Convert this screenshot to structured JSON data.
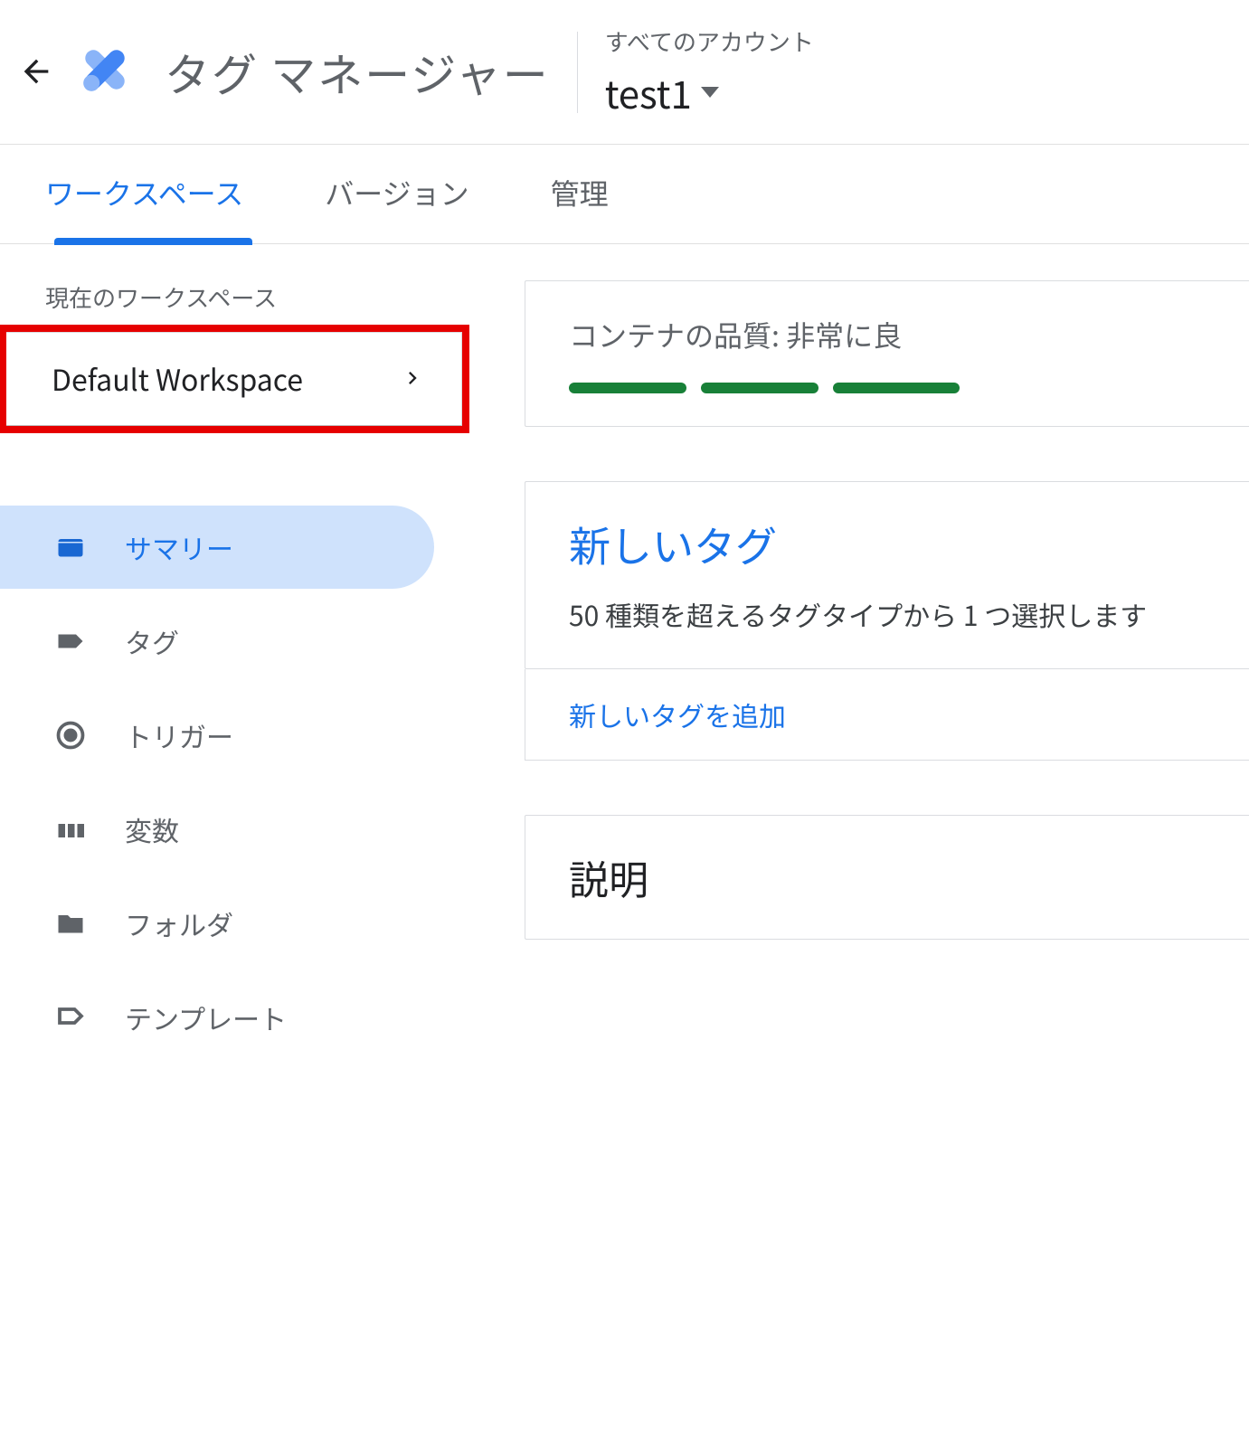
{
  "header": {
    "app_title": "タグ マネージャー",
    "account_label": "すべてのアカウント",
    "account_name": "test1"
  },
  "tabs": {
    "workspace": "ワークスペース",
    "version": "バージョン",
    "admin": "管理"
  },
  "sidebar": {
    "current_ws_label": "現在のワークスペース",
    "current_ws_name": "Default Workspace",
    "nav": {
      "summary": "サマリー",
      "tags": "タグ",
      "triggers": "トリガー",
      "variables": "変数",
      "folders": "フォルダ",
      "templates": "テンプレート"
    }
  },
  "main": {
    "quality_label": "コンテナの品質: 非常に良",
    "new_tag_title": "新しいタグ",
    "new_tag_desc": "50 種類を超えるタグタイプから 1 つ選択します",
    "add_new_tag_link": "新しいタグを追加",
    "description_title": "説明"
  }
}
